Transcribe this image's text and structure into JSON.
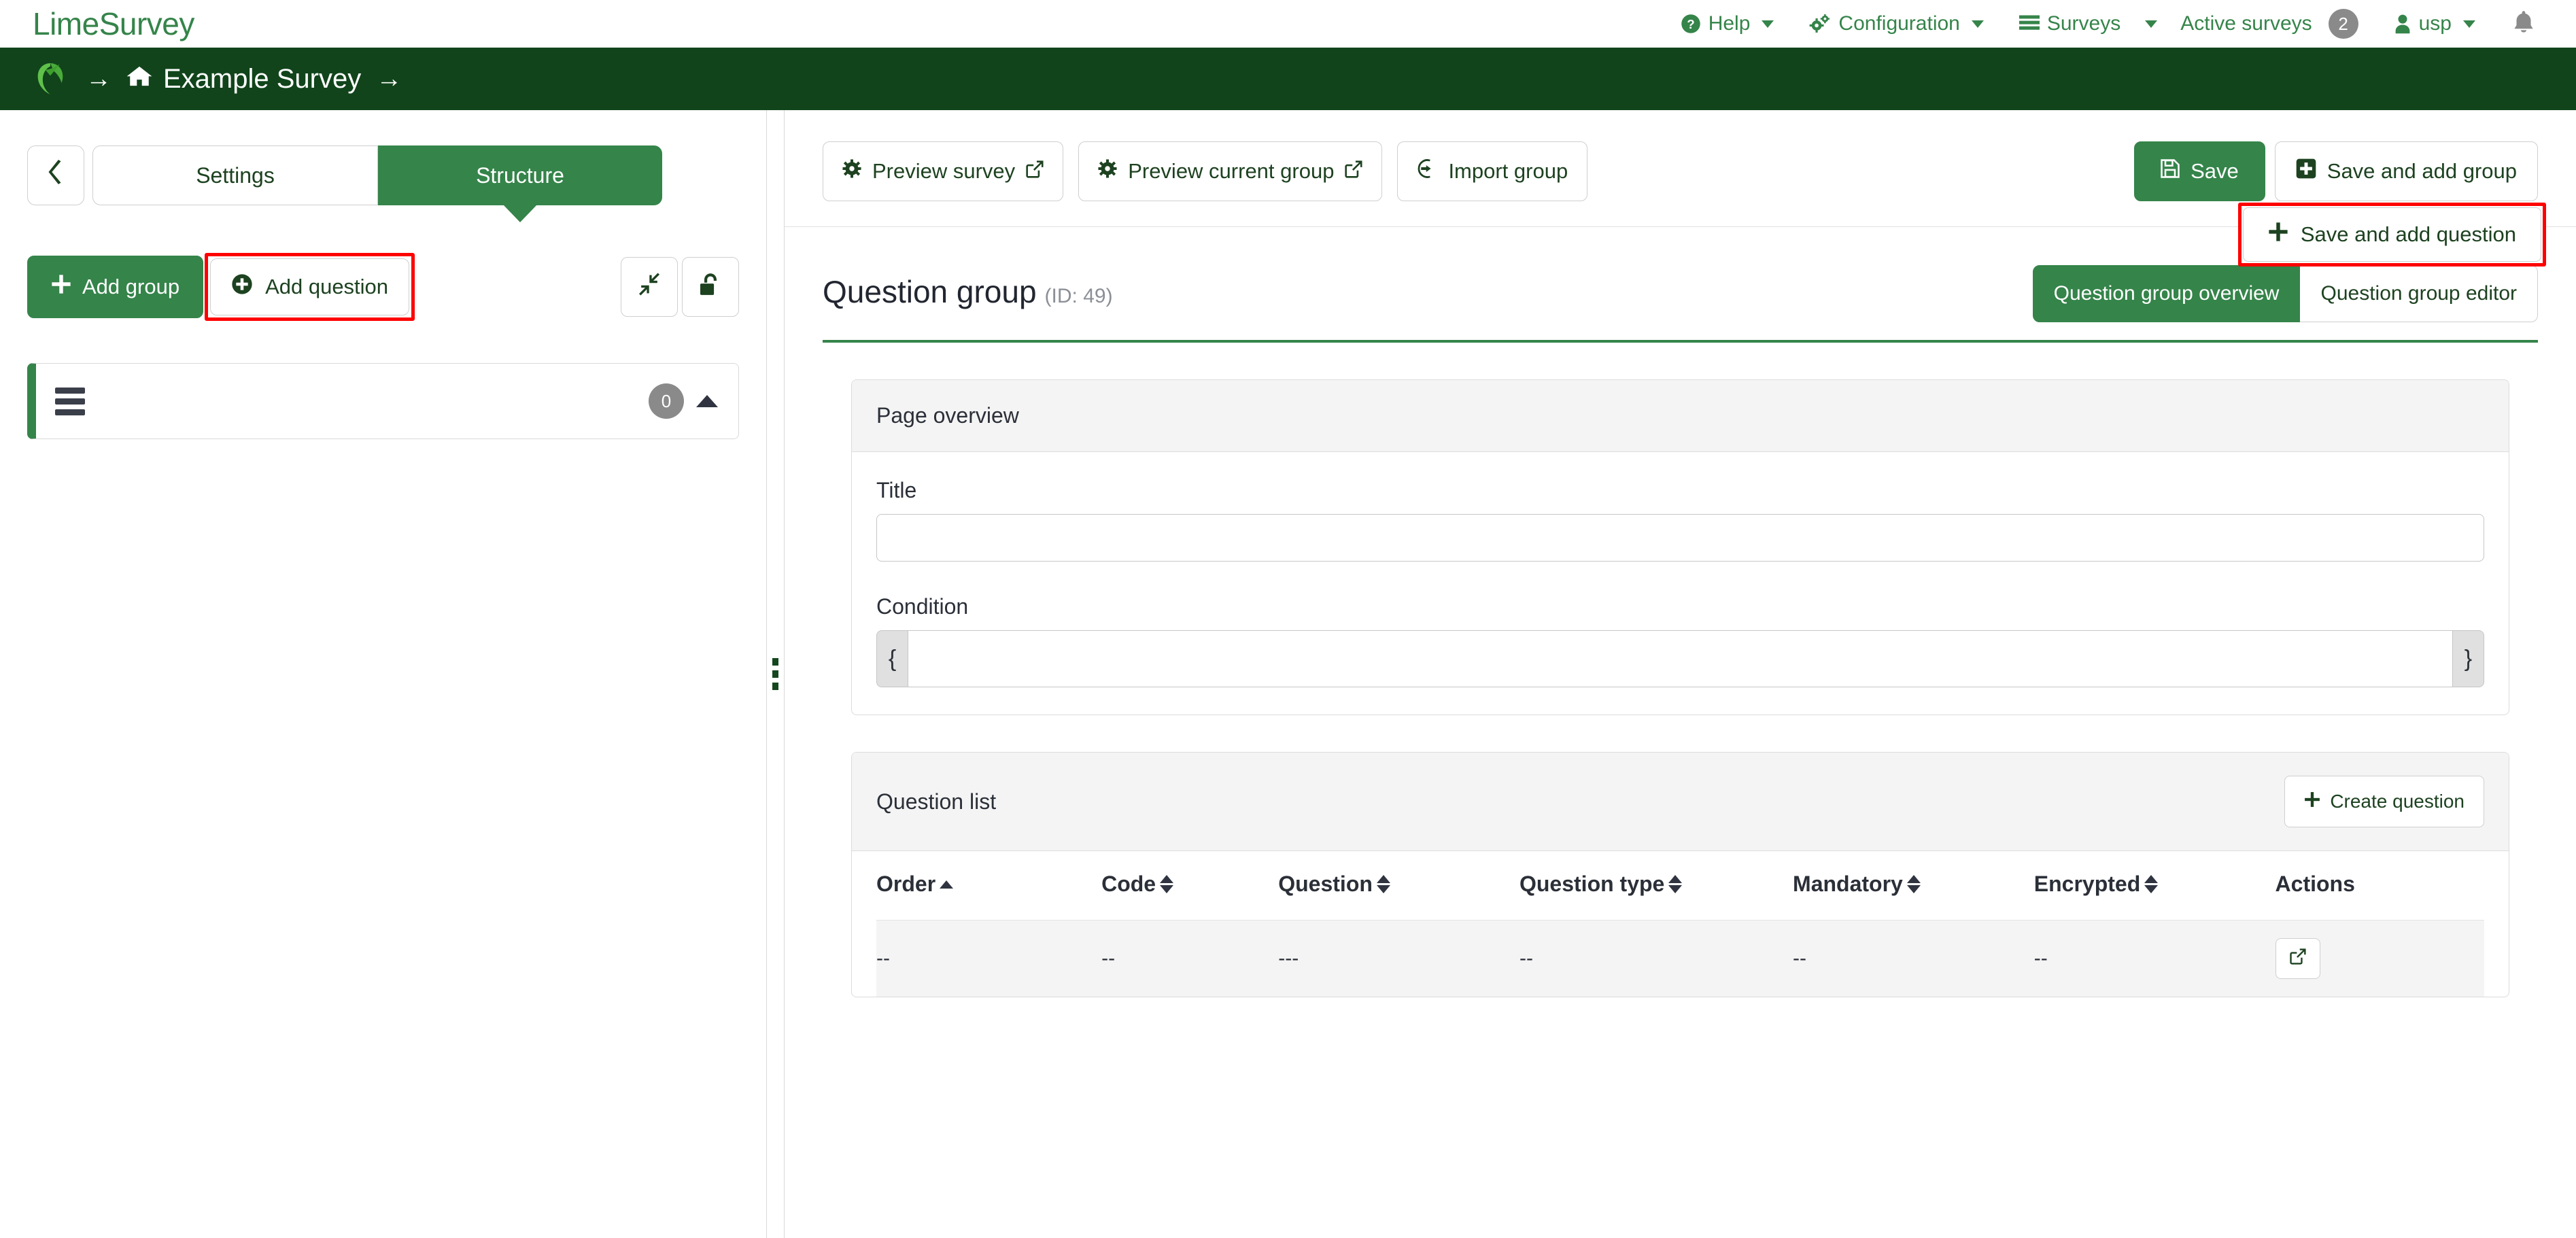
{
  "topnav": {
    "brand": "LimeSurvey",
    "items": [
      {
        "label": "Help",
        "icon": "help-circle-icon",
        "caret": true
      },
      {
        "label": "Configuration",
        "icon": "gears-icon",
        "caret": true
      },
      {
        "label": "Surveys",
        "icon": "list-icon",
        "caret": true
      },
      {
        "label": "Active surveys",
        "icon": "",
        "badge": "2"
      },
      {
        "label": "usp",
        "icon": "user-icon",
        "caret": true
      }
    ],
    "bell_icon": "bell-icon"
  },
  "breadcrumb": {
    "logo_icon": "limesurvey-logo-icon",
    "arrow": "→",
    "home_icon": "home-icon",
    "survey_name": "Example Survey",
    "trailing_arrow": "→"
  },
  "sidebar": {
    "collapse_icon": "chevron-left-icon",
    "tabs": [
      {
        "label": "Settings",
        "active": false
      },
      {
        "label": "Structure",
        "active": true
      }
    ],
    "add_group_label": "Add group",
    "add_group_icon": "plus-icon",
    "add_question_label": "Add question",
    "add_question_icon": "plus-circle-icon",
    "collapse_all_icon": "collapse-arrows-icon",
    "unlock_icon": "unlock-icon",
    "group_items": [
      {
        "drag_icon": "drag-handle-icon",
        "count": "0",
        "toggle_icon": "caret-up-icon"
      }
    ]
  },
  "resizer": {
    "icon": "vertical-grip-icon"
  },
  "toolbar": {
    "preview_survey_label": "Preview survey",
    "preview_survey_icon": "gear-icon",
    "preview_survey_ext_icon": "external-link-icon",
    "preview_group_label": "Preview current group",
    "preview_group_icon": "gear-icon",
    "preview_group_ext_icon": "external-link-icon",
    "import_group_label": "Import group",
    "import_group_icon": "import-icon",
    "save_label": "Save",
    "save_icon": "floppy-disk-icon",
    "save_add_group_label": "Save and add group",
    "save_add_group_icon": "plus-square-icon",
    "save_add_question_label": "Save and add question",
    "save_add_question_icon": "plus-icon"
  },
  "main": {
    "page_title": "Question group",
    "page_id": "(ID: 49)",
    "tabs": [
      {
        "label": "Question group overview",
        "active": true
      },
      {
        "label": "Question group editor",
        "active": false
      }
    ],
    "page_overview": {
      "header": "Page overview",
      "title_label": "Title",
      "title_value": "",
      "title_placeholder": "",
      "condition_label": "Condition",
      "condition_value": "",
      "condition_placeholder": "",
      "condition_prefix": "{",
      "condition_suffix": "}"
    },
    "question_list": {
      "header": "Question list",
      "create_question_label": "Create question",
      "create_question_icon": "plus-icon",
      "columns": [
        {
          "label": "Order",
          "sort": "asc"
        },
        {
          "label": "Code",
          "sort": "both"
        },
        {
          "label": "Question",
          "sort": "both"
        },
        {
          "label": "Question type",
          "sort": "both"
        },
        {
          "label": "Mandatory",
          "sort": "both"
        },
        {
          "label": "Encrypted",
          "sort": "both"
        },
        {
          "label": "Actions",
          "sort": "none"
        }
      ],
      "rows": [
        {
          "order": "--",
          "code": "--",
          "question": "---",
          "question_type": "--",
          "mandatory": "--",
          "encrypted": "--",
          "action_icon": "external-link-icon"
        }
      ]
    }
  },
  "colors": {
    "brand_green": "#35844a",
    "dark_green": "#11441b",
    "highlight_red": "#ff0000",
    "badge_gray": "#8a8a8a"
  }
}
